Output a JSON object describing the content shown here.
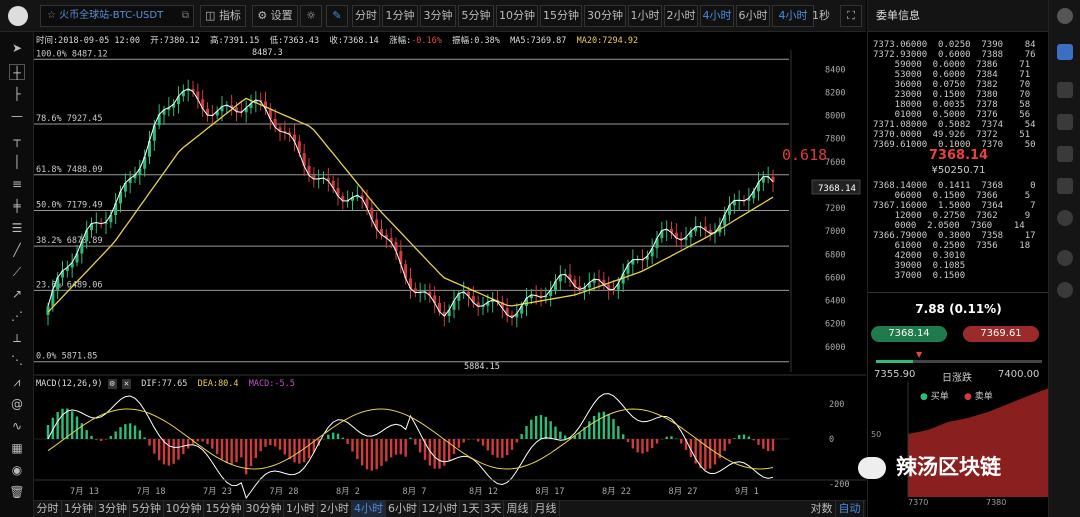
{
  "toolbar": {
    "symbol": "火币全球站-BTC-USDT",
    "indicator": "指标",
    "settings": "设置",
    "intervals": [
      "分时",
      "1分钟",
      "3分钟",
      "5分钟",
      "10分钟",
      "15分钟",
      "30分钟",
      "1小时",
      "2小时",
      "4小时",
      "6小时",
      "4小时"
    ],
    "active_index": 9,
    "refresh": "1秒"
  },
  "chart_info": {
    "date": "时间:2018-09-05 12:00",
    "open": "开:7380.12",
    "high": "高:7391.15",
    "low": "低:7363.43",
    "close": "收:7368.14",
    "change_label": "涨幅:",
    "change": "-0.16%",
    "amp": "振幅:0.38%",
    "ma5": "MA5:7369.87",
    "ma20": "MA20:7294.92"
  },
  "fib": [
    {
      "label": "100.0% 8487.12",
      "v": 8487.12
    },
    {
      "label": "78.6% 7927.45",
      "v": 7927.45
    },
    {
      "label": "61.8% 7488.09",
      "v": 7488.09
    },
    {
      "label": "50.0% 7179.49",
      "v": 7179.49
    },
    {
      "label": "38.2% 6870.89",
      "v": 6870.89
    },
    {
      "label": "23.6% 6489.06",
      "v": 6489.06
    },
    {
      "label": "0.0% 5871.85",
      "v": 5871.85
    }
  ],
  "annotations": {
    "high_marker": "8487.3",
    "low_marker": "5884.15",
    "fib_big": "0.618",
    "price_tag": "7368.14"
  },
  "price_axis": [
    "8400",
    "8200",
    "8000",
    "7800",
    "7600",
    "7400",
    "7200",
    "7000",
    "6800",
    "6600",
    "6400",
    "6200",
    "6000"
  ],
  "macd": {
    "title": "MACD(12,26,9)",
    "dif": "DIF:77.65",
    "dea": "DEA:80.4",
    "macd": "MACD:-5.5",
    "axis": [
      "200",
      "0",
      "-200"
    ]
  },
  "dates": [
    "7月 13",
    "7月 18",
    "7月 23",
    "7月 28",
    "8月 2",
    "8月 7",
    "8月 12",
    "8月 17",
    "8月 22",
    "8月 27",
    "9月 1"
  ],
  "bottom_intervals": [
    "分时",
    "1分钟",
    "3分钟",
    "5分钟",
    "10分钟",
    "15分钟",
    "30分钟",
    "1小时",
    "2小时",
    "4小时",
    "6小时",
    "12小时",
    "1天",
    "3天",
    "周线",
    "月线"
  ],
  "bottom_active": 9,
  "bottom_right": [
    "对数",
    "自动"
  ],
  "panel": {
    "title": "委单信息",
    "asks": [
      "7373.06000  0.0250  7390    84",
      "7372.93000  0.6000  7388    76",
      "    59000  0.6000  7386    71",
      "    53000  0.6000  7384    71",
      "    36000  0.0750  7382    70",
      "    23000  0.1500  7380    70",
      "    18000  0.0035  7378    58",
      "    01000  0.5000  7376    56",
      "7371.08000  0.5082  7374    54",
      "7370.0000  49.926  7372    51",
      "7369.61000  0.1000  7370    50"
    ],
    "last_price": "7368.14",
    "cny": "¥50250.71",
    "bids": [
      "7368.14000  0.1411  7368     0",
      "    06000  0.1500  7366     5",
      "7367.16000  1.5000  7364     7",
      "    12000  0.2750  7362     9",
      "    0000  2.0500  7360    14",
      "7366.79000  0.3000  7358    17",
      "    61000  0.2500  7356    18",
      "    42000  0.3010",
      "    39000  0.1085",
      "    37000  0.1500"
    ],
    "change": "7.88",
    "change_pct": "(0.11%)",
    "buy_price": "7368.14",
    "sell_price": "7369.61",
    "range_low": "7355.90",
    "range_label": "日涨跌",
    "range_high": "7400.00",
    "legend_buy": "买单",
    "legend_sell": "卖单",
    "depth_y": "50",
    "depth_x": [
      "7370",
      "7380"
    ]
  },
  "watermark": "辣汤区块链",
  "colors": {
    "up": "#2dbd7a",
    "down": "#d23b3b",
    "ma5": "#ffffff",
    "ma20": "#e6d24a",
    "accent": "#4a8be0"
  },
  "chart_data": {
    "type": "candlestick",
    "title": "火币全球站-BTC-USDT",
    "interval": "4小时",
    "ylim": [
      5800,
      8550
    ],
    "series": [
      {
        "name": "MA5",
        "x": [
          "7月 13",
          "7月 18",
          "7月 23",
          "7月 28",
          "8月 2",
          "8月 7",
          "8月 12",
          "8月 17",
          "8月 22",
          "8月 27",
          "9月 1",
          "9月 5"
        ],
        "values": [
          6350,
          7300,
          8150,
          8100,
          7600,
          7000,
          6300,
          6400,
          6500,
          6750,
          7100,
          7369.87
        ]
      },
      {
        "name": "MA20",
        "x": [
          "7月 13",
          "7月 18",
          "7月 23",
          "7月 28",
          "8月 2",
          "8月 7",
          "8月 12",
          "8月 17",
          "8月 22",
          "8月 27",
          "9月 1",
          "9月 5"
        ],
        "values": [
          6300,
          6900,
          7700,
          8150,
          7900,
          7200,
          6600,
          6350,
          6450,
          6650,
          6950,
          7294.92
        ]
      }
    ],
    "fib_levels": [
      8487.12,
      7927.45,
      7488.09,
      7179.49,
      6870.89,
      6489.06,
      5871.85
    ],
    "last": {
      "open": 7380.12,
      "high": 7391.15,
      "low": 7363.43,
      "close": 7368.14
    }
  }
}
